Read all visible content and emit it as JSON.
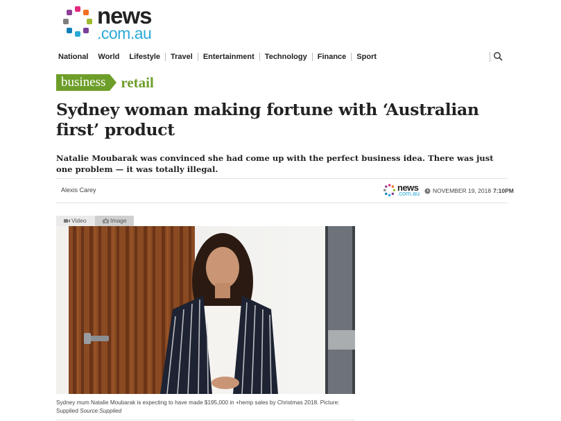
{
  "brand": {
    "word": "news",
    "sub": ".com.au"
  },
  "nav": {
    "items": [
      "National",
      "World",
      "Lifestyle",
      "Travel",
      "Entertainment",
      "Technology",
      "Finance",
      "Sport"
    ],
    "search_icon": "search-icon"
  },
  "section": {
    "category": "business",
    "subcategory": "retail"
  },
  "article": {
    "headline": "Sydney woman making fortune with ‘Australian first’ product",
    "standfirst": "Natalie Moubarak was convinced she had come up with the perfect business idea. There was just one problem — it was totally illegal.",
    "author": "Alexis Carey",
    "publisher": {
      "word": "news",
      "sub": ".com.au"
    },
    "date": "NOVEMBER 19, 2018",
    "time": "7:10PM"
  },
  "media": {
    "tabs": [
      {
        "label": "Video",
        "icon": "video-camera-icon"
      },
      {
        "label": "Image",
        "icon": "camera-icon"
      }
    ],
    "caption": "Sydney mum Natalie Moubarak is expecting to have made $195,000 in +hemp sales by Christmas 2018. Picture: Supplied",
    "source": "Source:Supplied"
  },
  "colors": {
    "accent_green": "#6e9e2a",
    "brand_blue": "#2aa9d8",
    "text": "#222222"
  }
}
